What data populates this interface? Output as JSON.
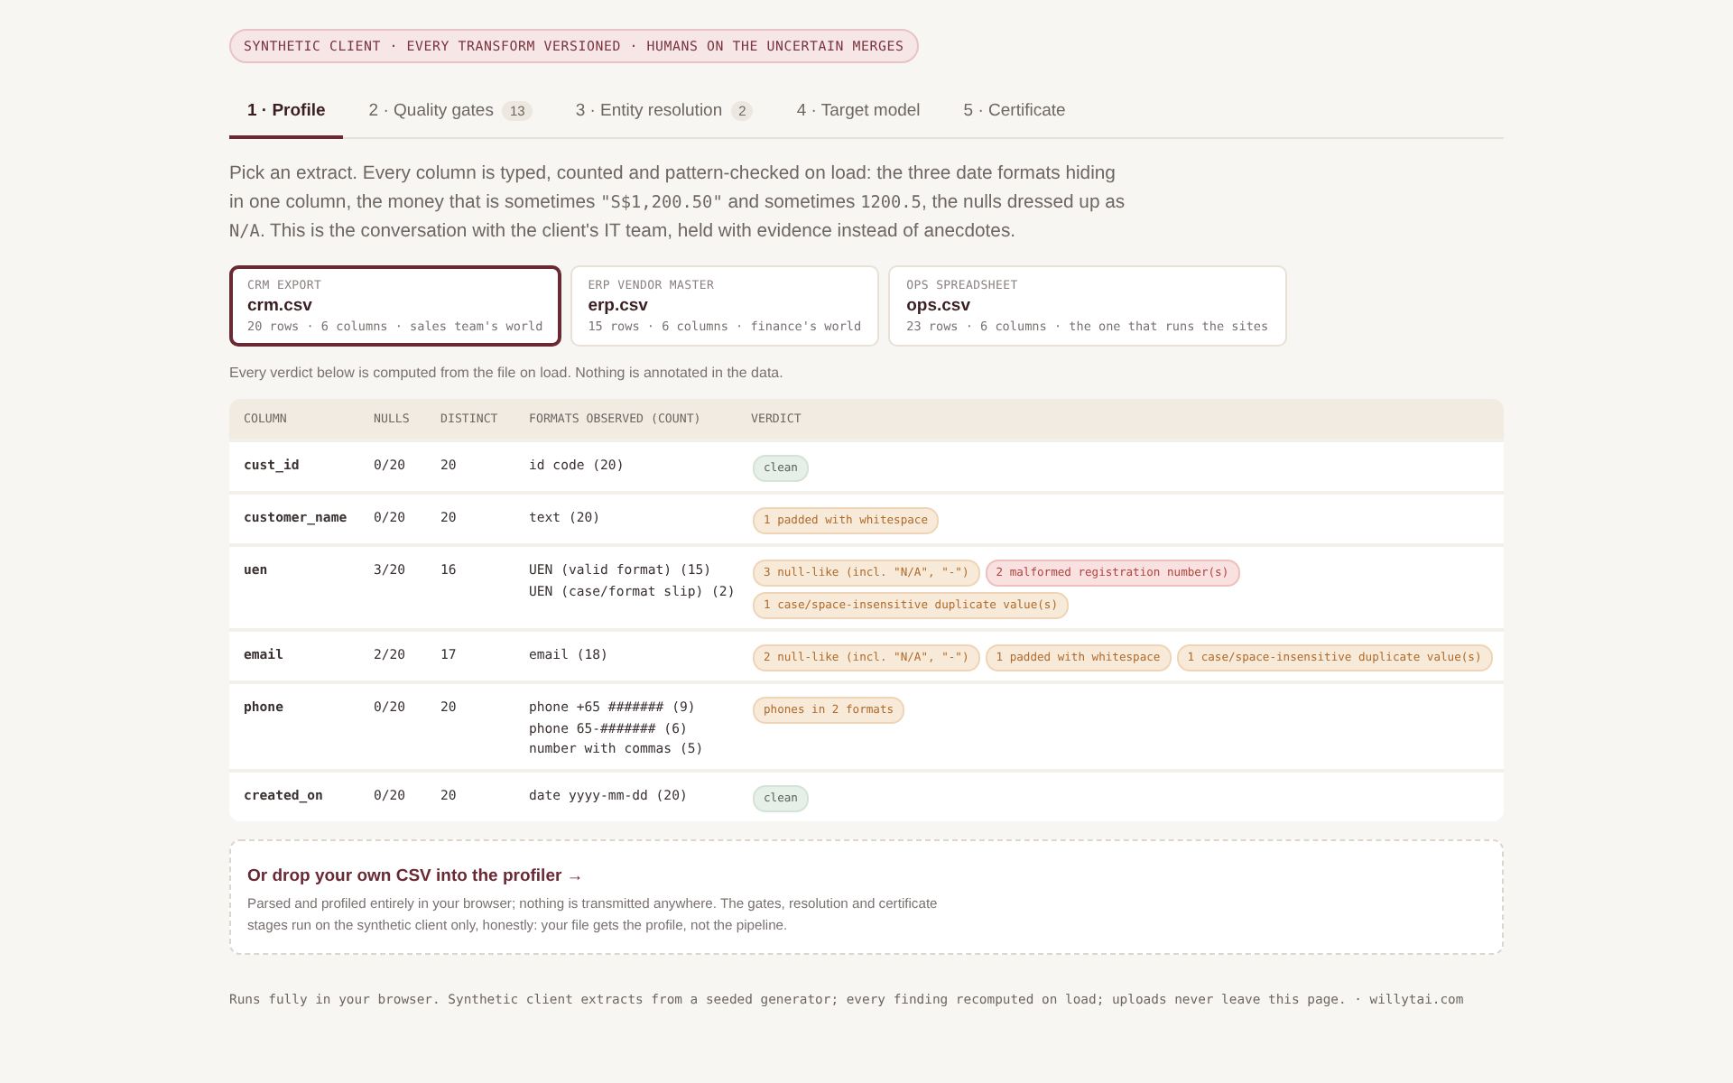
{
  "banner": "SYNTHETIC CLIENT · EVERY TRANSFORM VERSIONED · HUMANS ON THE UNCERTAIN MERGES",
  "tabs": [
    {
      "label": "1 · Profile",
      "selected": true
    },
    {
      "label": "2 · Quality gates",
      "badge": "13",
      "selected": false
    },
    {
      "label": "3 · Entity resolution",
      "badge": "2",
      "selected": false
    },
    {
      "label": "4 · Target model",
      "selected": false
    },
    {
      "label": "5 · Certificate",
      "selected": false
    }
  ],
  "intro": [
    {
      "kind": "text",
      "text": "Pick an extract. Every column is typed, counted and pattern-checked on load: the three date formats hiding in one column, the money that is sometimes "
    },
    {
      "kind": "code",
      "text": "\"S$1,200.50\""
    },
    {
      "kind": "text",
      "text": " and sometimes "
    },
    {
      "kind": "code",
      "text": "1200.5"
    },
    {
      "kind": "text",
      "text": ", the nulls dressed up as "
    },
    {
      "kind": "code",
      "text": "N/A"
    },
    {
      "kind": "text",
      "text": ". This is the conversation with the client's IT team, held with evidence instead of anecdotes."
    }
  ],
  "extracts": [
    {
      "source": "CRM EXPORT",
      "file": "crm.csv",
      "meta": "20 rows · 6 columns · sales team's world",
      "selected": true
    },
    {
      "source": "ERP VENDOR MASTER",
      "file": "erp.csv",
      "meta": "15 rows · 6 columns · finance's world",
      "selected": false
    },
    {
      "source": "OPS SPREADSHEET",
      "file": "ops.csv",
      "meta": "23 rows · 6 columns · the one that runs the sites",
      "selected": false
    }
  ],
  "note": "Every verdict below is computed from the file on load. Nothing is annotated in the data.",
  "table": {
    "columns": [
      "COLUMN",
      "NULLS",
      "DISTINCT",
      "FORMATS OBSERVED (COUNT)",
      "VERDICT"
    ],
    "rows": [
      {
        "column": "cust_id",
        "nulls": "0/20",
        "distinct": "20",
        "formats": [
          "id code (20)"
        ],
        "verdicts": [
          {
            "kind": "clean",
            "text": "clean"
          }
        ]
      },
      {
        "column": "customer_name",
        "nulls": "0/20",
        "distinct": "20",
        "formats": [
          "text (20)"
        ],
        "verdicts": [
          {
            "kind": "warn",
            "text": "1 padded with whitespace"
          }
        ]
      },
      {
        "column": "uen",
        "nulls": "3/20",
        "distinct": "16",
        "formats": [
          "UEN (valid format) (15)",
          "UEN (case/format slip) (2)"
        ],
        "verdicts": [
          {
            "kind": "warn",
            "text": "3 null-like (incl. \"N/A\", \"-\")"
          },
          {
            "kind": "error",
            "text": "2 malformed registration number(s)"
          },
          {
            "kind": "warn",
            "text": "1 case/space-insensitive duplicate value(s)"
          }
        ]
      },
      {
        "column": "email",
        "nulls": "2/20",
        "distinct": "17",
        "formats": [
          "email (18)"
        ],
        "verdicts": [
          {
            "kind": "warn",
            "text": "2 null-like (incl. \"N/A\", \"-\")"
          },
          {
            "kind": "warn",
            "text": "1 padded with whitespace"
          },
          {
            "kind": "warn",
            "text": "1 case/space-insensitive duplicate value(s)"
          }
        ]
      },
      {
        "column": "phone",
        "nulls": "0/20",
        "distinct": "20",
        "formats": [
          "phone +65 ####### (9)",
          "phone 65-####### (6)",
          "number with commas (5)"
        ],
        "verdicts": [
          {
            "kind": "warn",
            "text": "phones in 2 formats"
          }
        ]
      },
      {
        "column": "created_on",
        "nulls": "0/20",
        "distinct": "20",
        "formats": [
          "date yyyy-mm-dd (20)"
        ],
        "verdicts": [
          {
            "kind": "clean",
            "text": "clean"
          }
        ]
      }
    ]
  },
  "dropzone": {
    "title": "Or drop your own CSV into the profiler →",
    "text": "Parsed and profiled entirely in your browser; nothing is transmitted anywhere. The gates, resolution and certificate stages run on the synthetic client only, honestly: your file gets the profile, not the pipeline."
  },
  "footer": "Runs fully in your browser. Synthetic client extracts from a seeded generator; every finding recomputed on load; uploads never leave this page. · willytai.com"
}
